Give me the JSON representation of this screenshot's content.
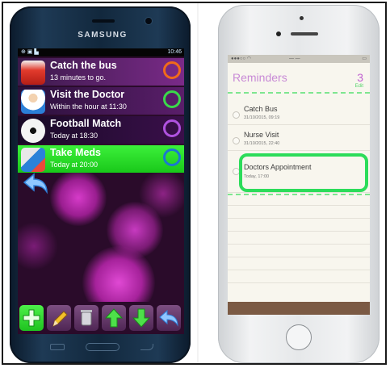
{
  "samsung": {
    "brand": "SAMSUNG",
    "status_time": "10:46",
    "reminders": [
      {
        "title": "Catch the bus",
        "subtitle": "13 minutes to go.",
        "alarm_color": "#f06a1a",
        "icon": "bus-icon",
        "highlighted": false
      },
      {
        "title": "Visit the Doctor",
        "subtitle": "Within the hour at 11:30",
        "alarm_color": "#3ad94a",
        "icon": "doctor-icon",
        "highlighted": false
      },
      {
        "title": "Football Match",
        "subtitle": "Today at 18:30",
        "alarm_color": "#b052e0",
        "icon": "football-icon",
        "highlighted": false
      },
      {
        "title": "Take Meds",
        "subtitle": "Today at 20:00",
        "alarm_color": "#1b78d0",
        "icon": "pills-icon",
        "highlighted": true
      }
    ],
    "toolbar_icons": [
      "add-icon",
      "pencil-icon",
      "trash-icon",
      "arrow-up-icon",
      "arrow-down-icon",
      "back-icon"
    ],
    "colors": {
      "highlight": "#22e02a",
      "background": "#2a0b2a",
      "accent_purple": "#c321b8"
    }
  },
  "iphone": {
    "title": "Reminders",
    "count": "3",
    "edit": "Edit",
    "items": [
      {
        "title": "Catch Bus",
        "subtitle": "31/10/2015, 09:19"
      },
      {
        "title": "Nurse Visit",
        "subtitle": "31/10/2015, 22:40"
      },
      {
        "title": "Doctors Appointment",
        "subtitle": "Today, 17:00"
      }
    ],
    "colors": {
      "title": "#c88ad6",
      "highlight": "#2cdc5a"
    }
  }
}
